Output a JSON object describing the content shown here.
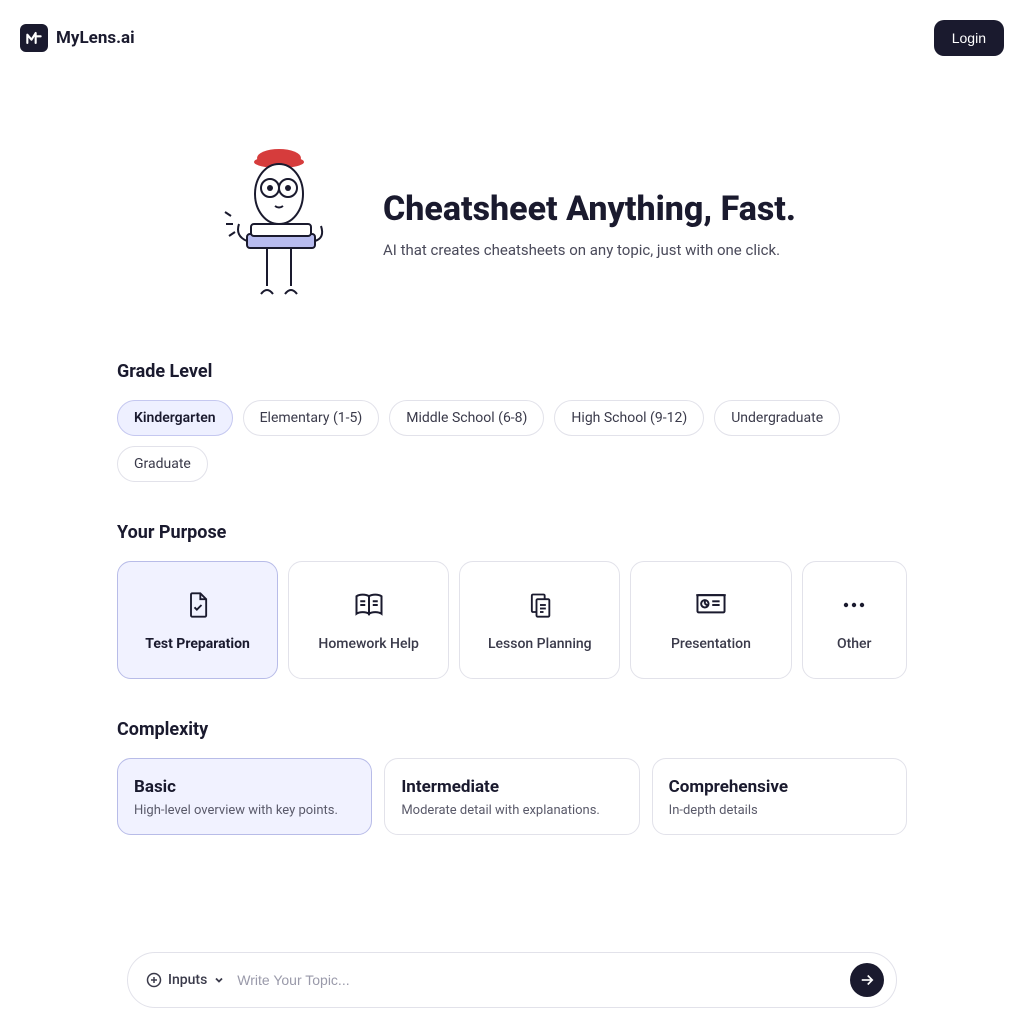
{
  "brand": "MyLens.ai",
  "login": "Login",
  "hero": {
    "title": "Cheatsheet Anything, Fast.",
    "subtitle": "AI that creates cheatsheets on any topic, just with one click."
  },
  "sections": {
    "grade": {
      "title": "Grade Level",
      "options": [
        "Kindergarten",
        "Elementary (1-5)",
        "Middle School (6-8)",
        "High School (9-12)",
        "Undergraduate",
        "Graduate"
      ],
      "selected": 0
    },
    "purpose": {
      "title": "Your Purpose",
      "options": [
        {
          "label": "Test Preparation",
          "icon": "file-check"
        },
        {
          "label": "Homework Help",
          "icon": "book-open"
        },
        {
          "label": "Lesson Planning",
          "icon": "clipboard"
        },
        {
          "label": "Presentation",
          "icon": "presentation"
        },
        {
          "label": "Other",
          "icon": "dots"
        }
      ],
      "selected": 0
    },
    "complexity": {
      "title": "Complexity",
      "options": [
        {
          "title": "Basic",
          "desc": "High-level overview with key points."
        },
        {
          "title": "Intermediate",
          "desc": "Moderate detail with explanations."
        },
        {
          "title": "Comprehensive",
          "desc": "In-depth details"
        }
      ],
      "selected": 0
    }
  },
  "inputBar": {
    "inputsLabel": "Inputs",
    "placeholder": "Write Your Topic..."
  },
  "colors": {
    "dark": "#1a1a2e",
    "selectedBg": "#f1f2ff",
    "selectedBorder": "#b8bce8"
  }
}
